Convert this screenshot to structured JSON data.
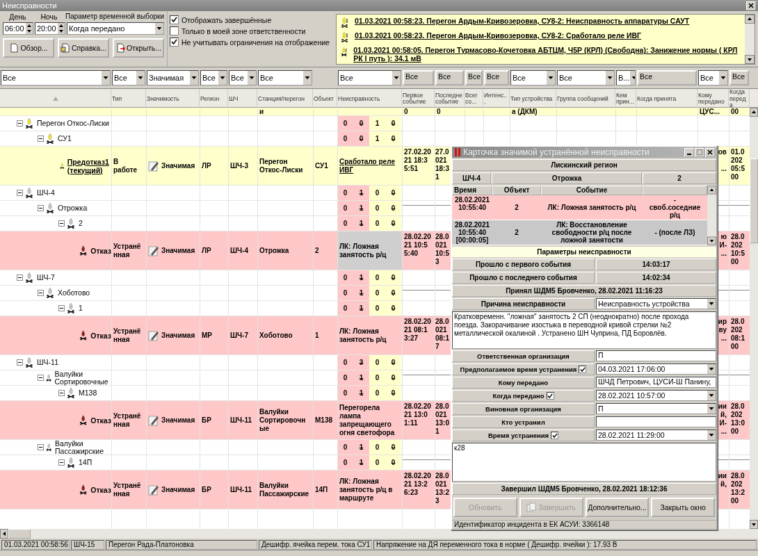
{
  "window": {
    "title": "Неисправности"
  },
  "time_filter": {
    "day_label": "День",
    "day": "06:00",
    "night_label": "Ночь",
    "night": "20:00",
    "param_label": "Параметр временной выборки",
    "param": "Когда передано"
  },
  "buttons": [
    "Обзор...",
    "Справка...",
    "Открыть..."
  ],
  "options": [
    {
      "label": "Отображать завершённые",
      "checked": true
    },
    {
      "label": "Только в моей зоне ответственности",
      "checked": false
    },
    {
      "label": "Не учитывать ограничения на  отображение",
      "checked": true
    }
  ],
  "notifications": [
    "01.03.2021 00:58:23. Перегон Ардым-Кривозеровка, СУ8-2: Неисправность аппаратуры САУТ",
    "01.03.2021 00:58:23. Перегон Ардым-Кривозеровка, СУ8-2: Сработало реле ИВГ",
    "01.03.2021 00:58:05. Перегон Турмасово-Кочетовка АБТЦМ, Ч5Р (КРЛ) (Свободна): Занижение нормы ( КРЛ РК I путь ): 34.1 мВ"
  ],
  "table": {
    "columns": [
      {
        "filter": {
          "kind": "dropdown",
          "value": "Все"
        }
      },
      {
        "title": "Тип",
        "filter": {
          "kind": "dropdown",
          "value": "Все"
        }
      },
      {
        "title": "Значимость",
        "filter": {
          "kind": "dropdown",
          "value": "Значимая"
        }
      },
      {
        "title": "Регион",
        "filter": {
          "kind": "dropdown",
          "value": "Все"
        }
      },
      {
        "title": "ШЧ",
        "filter": {
          "kind": "dropdown",
          "value": "Все"
        }
      },
      {
        "title": "Станция/перегон",
        "filter": {
          "kind": "dropdown",
          "value": "Все"
        }
      },
      {
        "title": "Объект"
      },
      {
        "title": "Неисправность",
        "filter": {
          "kind": "dropdown",
          "value": "Все"
        }
      },
      {
        "title": "Первое событие",
        "filter": {
          "kind": "box",
          "value": "Все"
        }
      },
      {
        "title": "Последне событие",
        "filter": {
          "kind": "box",
          "value": "Все"
        }
      },
      {
        "title": "Всег со...",
        "filter": {
          "kind": "box",
          "value": "Все"
        }
      },
      {
        "title": "Интенс...",
        "filter": {
          "kind": "box",
          "value": "Все"
        }
      },
      {
        "title": "Тип устройства",
        "filter": {
          "kind": "dropdown",
          "value": "Все"
        }
      },
      {
        "title": "Группа сообщений",
        "filter": {
          "kind": "dropdown",
          "value": "Все"
        }
      },
      {
        "title": "Кем прин...",
        "filter": {
          "kind": "dropdown",
          "value": "В..."
        }
      },
      {
        "title": "Когда принята",
        "filter": {
          "kind": "box",
          "value": "Все"
        }
      },
      {
        "title": "Кому передано",
        "filter": {
          "kind": "dropdown",
          "value": "Все"
        }
      },
      {
        "title": "Когда переда",
        "filter": {
          "kind": "box",
          "value": "Все"
        }
      }
    ],
    "partial_row": {
      "station": "и",
      "first_event": "0",
      "last_event": "0",
      "device": "а (ДКМ)",
      "to": "ЦУС...",
      "when": "00"
    },
    "tree": [
      {
        "kind": "group",
        "label": "Перегон Откос-Лиски",
        "warning": true,
        "expanded": true,
        "counts": [
          {
            "value": "0",
            "struck": false
          },
          {
            "value": "0",
            "struck": true
          },
          {
            "value": "1",
            "struck": false
          },
          {
            "value": "0",
            "struck": true
          }
        ],
        "children": [
          {
            "kind": "group",
            "label": "СУ1",
            "warning": true,
            "expanded": true,
            "counts": [
              {
                "value": "0",
                "struck": false
              },
              {
                "value": "0",
                "struck": true
              },
              {
                "value": "1",
                "struck": false
              },
              {
                "value": "0",
                "struck": true
              }
            ],
            "children": [
              {
                "kind": "incident",
                "label": "Предотказ1 (текущий)",
                "current": true,
                "failure": false,
                "selected": false,
                "type": "В работе",
                "significance": "Значимая",
                "region": "ЛР",
                "shch": "ШЧ-3",
                "station": "Перегон Откос-Лиски",
                "object": "СУ1",
                "fault": "Сработало реле ИВГ",
                "first_event": "27.02.2021 18:35:51",
                "last_event": "27.0\n021\n18:3\n1",
                "to": "ов\n\n...",
                "when": "01.0\n202\n05:5\n00"
              }
            ]
          }
        ]
      },
      {
        "kind": "group",
        "label": "ШЧ-4",
        "warning": false,
        "expanded": true,
        "counts": [
          {
            "value": "0",
            "struck": false
          },
          {
            "value": "1",
            "struck": true
          },
          {
            "value": "0",
            "struck": false
          },
          {
            "value": "0",
            "struck": true
          }
        ],
        "children": [
          {
            "kind": "group",
            "label": "Отрожка",
            "warning": false,
            "expanded": true,
            "counts": [
              {
                "value": "0",
                "struck": false
              },
              {
                "value": "1",
                "struck": true
              },
              {
                "value": "0",
                "struck": false
              },
              {
                "value": "0",
                "struck": true
              }
            ],
            "children": [
              {
                "kind": "group",
                "label": "2",
                "warning": false,
                "expanded": true,
                "counts": [
                  {
                    "value": "0",
                    "struck": false
                  },
                  {
                    "value": "1",
                    "struck": true
                  },
                  {
                    "value": "0",
                    "struck": false
                  },
                  {
                    "value": "0",
                    "struck": true
                  }
                ],
                "children": [
                  {
                    "kind": "incident",
                    "label": "Отказ",
                    "current": false,
                    "failure": true,
                    "selected": true,
                    "type": "Устранённая",
                    "significance": "Значимая",
                    "region": "ЛР",
                    "shch": "ШЧ-4",
                    "station": "Отрожка",
                    "object": "2",
                    "fault": "ЛК: Ложная занятость р/ц",
                    "first_event": "28.02.2021 10:55:40",
                    "last_event": "28.0\n021\n10:5\n3",
                    "to": "ю\nИ-\n...",
                    "when": "28.0\n202\n10:5\n00"
                  }
                ]
              }
            ]
          }
        ]
      },
      {
        "kind": "group",
        "label": "ШЧ-7",
        "warning": false,
        "expanded": true,
        "counts": [
          {
            "value": "0",
            "struck": false
          },
          {
            "value": "1",
            "struck": true
          },
          {
            "value": "0",
            "struck": false
          },
          {
            "value": "0",
            "struck": true
          }
        ],
        "children": [
          {
            "kind": "group",
            "label": "Хоботово",
            "warning": false,
            "expanded": true,
            "counts": [
              {
                "value": "0",
                "struck": false
              },
              {
                "value": "1",
                "struck": true
              },
              {
                "value": "0",
                "struck": false
              },
              {
                "value": "0",
                "struck": true
              }
            ],
            "children": [
              {
                "kind": "group",
                "label": "1",
                "warning": false,
                "expanded": true,
                "counts": [
                  {
                    "value": "0",
                    "struck": false
                  },
                  {
                    "value": "1",
                    "struck": true
                  },
                  {
                    "value": "0",
                    "struck": false
                  },
                  {
                    "value": "0",
                    "struck": true
                  }
                ],
                "children": [
                  {
                    "kind": "incident",
                    "label": "Отказ",
                    "current": false,
                    "failure": true,
                    "selected": false,
                    "type": "Устранённая",
                    "significance": "Значимая",
                    "region": "МР",
                    "shch": "ШЧ-7",
                    "station": "Хоботово",
                    "object": "1",
                    "fault": "ЛК: Ложная занятость р/ц",
                    "first_event": "28.02.2021 08:13:27",
                    "last_event": "28.0\n021\n08:1\n7",
                    "to": "ир\nву\n...",
                    "when": "28.0\n202\n08:1\n00"
                  }
                ]
              }
            ]
          }
        ]
      },
      {
        "kind": "group",
        "label": "ШЧ-11",
        "warning": false,
        "expanded": true,
        "counts": [
          {
            "value": "0",
            "struck": false
          },
          {
            "value": "3",
            "struck": true
          },
          {
            "value": "0",
            "struck": false
          },
          {
            "value": "0",
            "struck": true
          }
        ],
        "children": [
          {
            "kind": "group",
            "label": "Валуйки Сортировочные",
            "warning": false,
            "expanded": true,
            "counts": [
              {
                "value": "0",
                "struck": false
              },
              {
                "value": "1",
                "struck": true
              },
              {
                "value": "0",
                "struck": false
              },
              {
                "value": "0",
                "struck": true
              }
            ],
            "children": [
              {
                "kind": "group",
                "label": "М138",
                "warning": false,
                "expanded": true,
                "counts": [
                  {
                    "value": "0",
                    "struck": false
                  },
                  {
                    "value": "1",
                    "struck": true
                  },
                  {
                    "value": "0",
                    "struck": false
                  },
                  {
                    "value": "0",
                    "struck": true
                  }
                ],
                "children": [
                  {
                    "kind": "incident",
                    "label": "Отказ",
                    "current": false,
                    "failure": true,
                    "selected": false,
                    "type": "Устранённая",
                    "significance": "Значимая",
                    "region": "БР",
                    "shch": "ШЧ-11",
                    "station": "Валуйки Сортировочные",
                    "object": "М138",
                    "fault": "Перегорела лампа запрещающего огня светофора",
                    "first_event": "28.02.2021 13:01:11",
                    "last_event": "28.0\n021\n13:0\n1",
                    "to": "ии\nй,\nИ-\n...",
                    "when": "28.0\n202\n13:0\n00"
                  }
                ]
              }
            ]
          },
          {
            "kind": "group",
            "label": "Валуйки Пассажирские",
            "warning": false,
            "expanded": true,
            "counts": [
              {
                "value": "0",
                "struck": false
              },
              {
                "value": "1",
                "struck": true
              },
              {
                "value": "0",
                "struck": false
              },
              {
                "value": "0",
                "struck": true
              }
            ],
            "children": [
              {
                "kind": "group",
                "label": "14П",
                "warning": false,
                "expanded": true,
                "counts": [
                  {
                    "value": "0",
                    "struck": false
                  },
                  {
                    "value": "1",
                    "struck": true
                  },
                  {
                    "value": "0",
                    "struck": false
                  },
                  {
                    "value": "0",
                    "struck": true
                  }
                ],
                "children": [
                  {
                    "kind": "incident",
                    "label": "Отказ",
                    "current": false,
                    "failure": true,
                    "selected": false,
                    "type": "Устранённая",
                    "significance": "Значимая",
                    "region": "БР",
                    "shch": "ШЧ-11",
                    "station": "Валуйки Пассажирские",
                    "object": "14П",
                    "fault": "ЛК: Ложная занятость р/ц в маршруте",
                    "first_event": "28.02.2021 13:26:23",
                    "last_event": "28.0\n021\n13:2\n3",
                    "to": "ии\nй,",
                    "when": "28.0\n202\n13:2\n00"
                  }
                ]
              }
            ]
          }
        ]
      }
    ]
  },
  "dialog": {
    "title": "Карточка значимой устранённой неисправности",
    "region": "Лискинский регион",
    "shch": "ШЧ-4",
    "station": "Отрожка",
    "object": "2",
    "event_columns": [
      "Время",
      "Объект",
      "Событие"
    ],
    "events": [
      {
        "time": "28.02.2021\n10:55:40",
        "object": "2",
        "event": "ЛК: Ложная занятость р/ц",
        "note": "-\nсвоб.соседние\nр/ц",
        "restored": false
      },
      {
        "time": "28.02.2021\n10:55:40\n[00:00:05]",
        "object": "2",
        "event": "ЛК: Восстановление свободности р/ц после ложной занятости",
        "note": "- (после ЛЗ)",
        "restored": true
      }
    ],
    "params_title": "Параметры неисправности",
    "elapsed": [
      {
        "label": "Прошло с первого события",
        "value": "14:03:17"
      },
      {
        "label": "Прошло с последнего события",
        "value": "14:02:34"
      }
    ],
    "accepted": "Принял ШДМ5 Бровченко, 28.02.2021 11:16:23",
    "cause_label": "Причина неисправности",
    "cause": "Неисправность устройства",
    "description": "Кратковременн. \"ложная\" занятость 2 СП (неоднократно) после прохода поезда. Закорачивание изостыка в переводной кривой стрелки №2 металлической окалиной . Устранено ШН Чуприна, ПД Боровлёв.",
    "fields": [
      {
        "label": "Ответственная организация",
        "kind": "text",
        "value": "П"
      },
      {
        "label": "Предполагаемое время устранения",
        "kind": "dropdown",
        "checked": true,
        "value": "04.03.2021 17:06:00"
      },
      {
        "label": "Кому передано",
        "kind": "text",
        "value": "ШЧД Петрович, ЦУСИ-Ш Панину,"
      },
      {
        "label": "Когда передано",
        "kind": "dropdown",
        "checked": true,
        "value": "28.02.2021 10:57:00"
      },
      {
        "label": "Виновная организация",
        "kind": "dropdown",
        "value": "П"
      },
      {
        "label": "Кто устранил",
        "kind": "text"
      },
      {
        "label": "Время устранения",
        "kind": "dropdown",
        "checked": true,
        "value": "28.02.2021 11:29:00"
      }
    ],
    "note": "к28",
    "completed": "Завершил ШДМ5 Бровченко, 28.02.2021 18:12:36",
    "buttons": [
      {
        "label": "Обновить",
        "kind": "plain",
        "disabled": true
      },
      {
        "label": "Завершить",
        "kind": "with_icon",
        "disabled": true
      },
      {
        "label": "Дополнительно...",
        "kind": "plain",
        "disabled": false
      },
      {
        "label": "Закрыть окно",
        "kind": "plain",
        "disabled": false
      }
    ],
    "incident_id": "Идентификатор инцидента в ЕК АСУИ: 3366148"
  },
  "status_bar": [
    "01.03.2021 00:58:56",
    "ШЧ-15",
    "Перегон Рада-Платоновка",
    "Дешифр. ячейка перем. тока СУ1",
    "Напряжение на ДЯ переменного тока в норме ( Дешифр. ячейки ): 17.93  В"
  ]
}
